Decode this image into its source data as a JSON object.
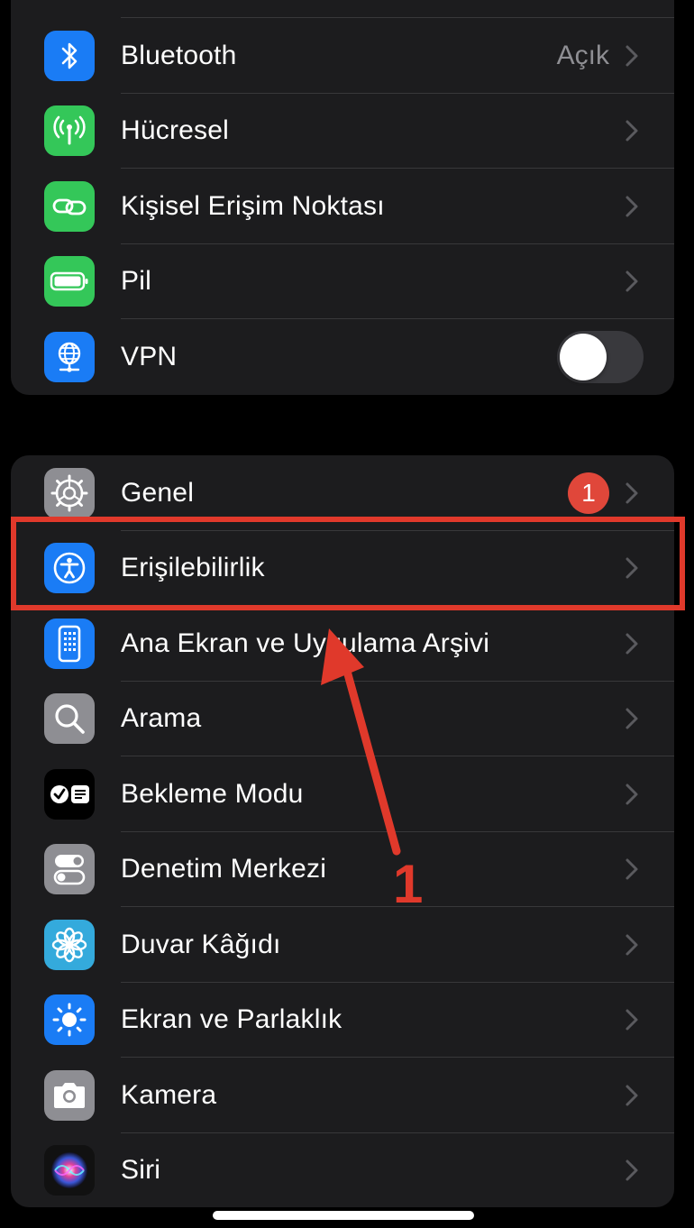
{
  "colors": {
    "background": "#000000",
    "group_bg": "#1c1c1e",
    "separator": "#38383a",
    "secondary_text": "#8e8e93",
    "badge": "#e0473a",
    "annotation": "#e0392b"
  },
  "network_group": {
    "items": [
      {
        "label": "Bluetooth",
        "value": "Açık",
        "icon": "bluetooth-icon",
        "icon_color": "#1a7cf5"
      },
      {
        "label": "Hücresel",
        "icon": "antenna-icon",
        "icon_color": "#34c759"
      },
      {
        "label": "Kişisel Erişim Noktası",
        "icon": "link-chain-icon",
        "icon_color": "#34c759"
      },
      {
        "label": "Pil",
        "icon": "battery-icon",
        "icon_color": "#34c759"
      },
      {
        "label": "VPN",
        "icon": "globe-network-icon",
        "icon_color": "#1a7cf5",
        "toggle_on": false
      }
    ]
  },
  "general_group": {
    "items": [
      {
        "label": "Genel",
        "badge": "1",
        "icon": "gear-icon",
        "icon_color": "#8e8e93"
      },
      {
        "label": "Erişilebilirlik",
        "icon": "accessibility-icon",
        "icon_color": "#1a7cf5"
      },
      {
        "label": "Ana Ekran ve Uygulama Arşivi",
        "icon": "home-screen-icon",
        "icon_color": "#1a7cf5"
      },
      {
        "label": "Arama",
        "icon": "search-icon",
        "icon_color": "#8e8e93"
      },
      {
        "label": "Bekleme Modu",
        "icon": "standby-icon",
        "icon_color": "#000000"
      },
      {
        "label": "Denetim Merkezi",
        "icon": "switches-icon",
        "icon_color": "#8e8e93"
      },
      {
        "label": "Duvar Kâğıdı",
        "icon": "flower-icon",
        "icon_color": "#34aadc"
      },
      {
        "label": "Ekran ve Parlaklık",
        "icon": "sun-icon",
        "icon_color": "#1a7cf5"
      },
      {
        "label": "Kamera",
        "icon": "camera-icon",
        "icon_color": "#8e8e93"
      },
      {
        "label": "Siri",
        "icon": "siri-icon",
        "icon_color": "#1c1c1e"
      }
    ]
  },
  "annotation": {
    "number": "1"
  }
}
